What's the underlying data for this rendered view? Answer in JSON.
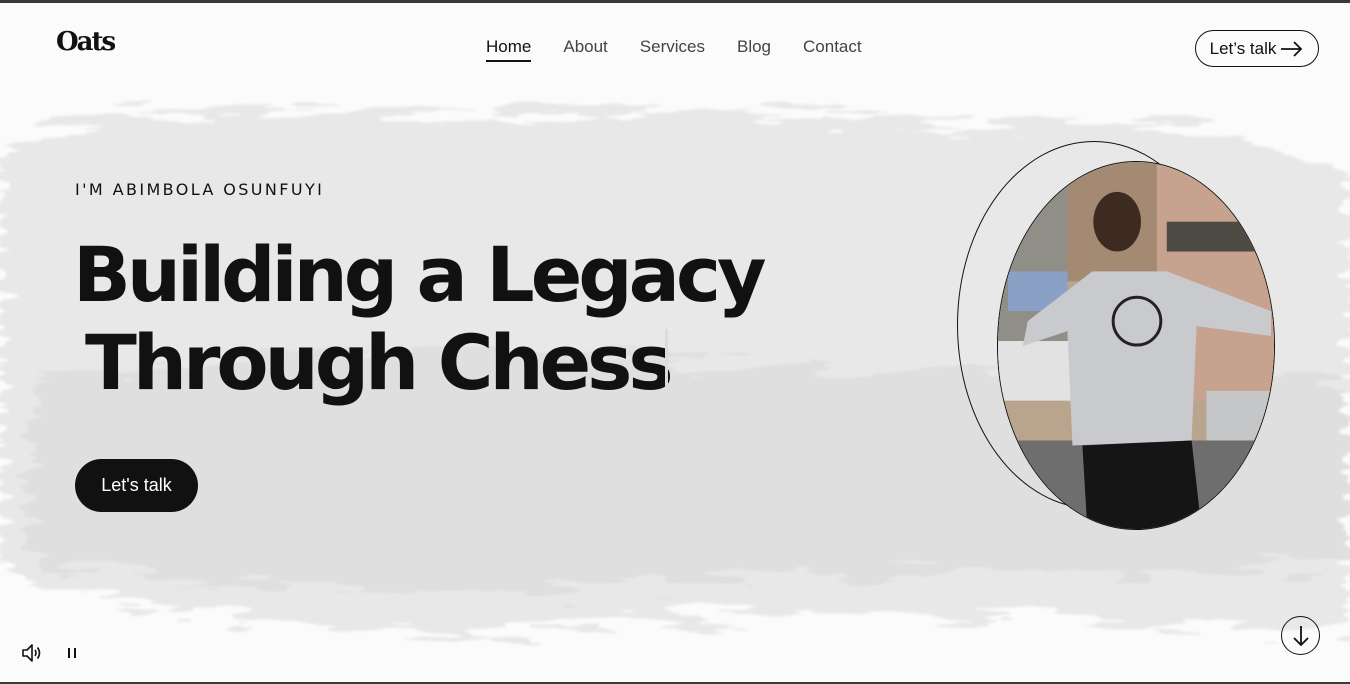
{
  "brand": {
    "logo_text": "Oats"
  },
  "nav": {
    "items": [
      {
        "label": "Home",
        "active": true
      },
      {
        "label": "About",
        "active": false
      },
      {
        "label": "Services",
        "active": false
      },
      {
        "label": "Blog",
        "active": false
      },
      {
        "label": "Contact",
        "active": false
      }
    ]
  },
  "header": {
    "cta_label": "Let’s talk",
    "cta_icon": "arrow-right-icon"
  },
  "hero": {
    "eyebrow": "I'M ABIMBOLA OSUNFUYI",
    "headline_line1": "Building a Legacy",
    "headline_line2": "Through Chess",
    "cta_label": "Let's talk",
    "portrait_icon": "portrait-photo"
  },
  "media_controls": {
    "sound_icon": "speaker-icon",
    "pause_icon": "pause-icon"
  },
  "scroll": {
    "icon": "arrow-down-icon"
  },
  "colors": {
    "ink": "#111111",
    "background": "#fbfbfb",
    "brush_grey": "#e6e6e6"
  }
}
